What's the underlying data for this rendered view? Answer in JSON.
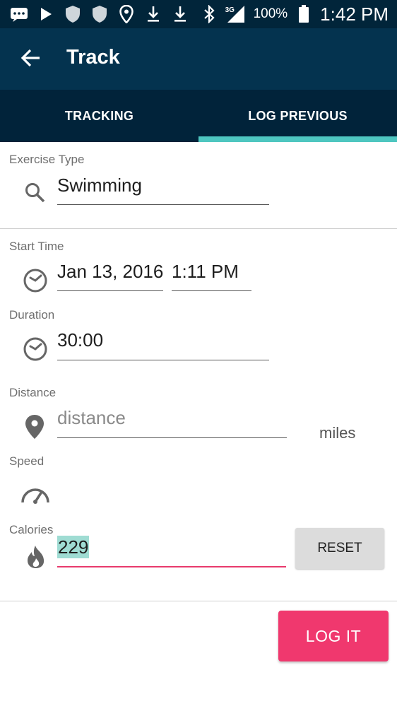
{
  "status_bar": {
    "network": "3G",
    "battery": "100%",
    "time": "1:42 PM"
  },
  "app_bar": {
    "title": "Track"
  },
  "tabs": [
    {
      "label": "TRACKING",
      "selected": false
    },
    {
      "label": "LOG PREVIOUS",
      "selected": true
    }
  ],
  "form": {
    "exercise_type": {
      "label": "Exercise Type",
      "value": "Swimming",
      "icon": "search-icon"
    },
    "start_time": {
      "label": "Start Time",
      "date": "Jan 13, 2016",
      "time": "1:11 PM",
      "icon": "clock-icon"
    },
    "duration": {
      "label": "Duration",
      "value": "30:00",
      "icon": "clock-icon"
    },
    "distance": {
      "label": "Distance",
      "placeholder": "distance",
      "units": "miles",
      "icon": "location-pin-icon"
    },
    "speed": {
      "label": "Speed",
      "icon": "speedometer-icon"
    },
    "calories": {
      "label": "Calories",
      "value": "229",
      "icon": "flame-icon"
    }
  },
  "buttons": {
    "reset": "RESET",
    "log_it": "LOG IT"
  },
  "colors": {
    "status_bar": "#01253a",
    "app_bar": "#04334f",
    "tabs": "#01233a",
    "tab_indicator": "#4ec6c0",
    "accent_pink": "#f0386e",
    "highlight": "#9fdcd3"
  }
}
